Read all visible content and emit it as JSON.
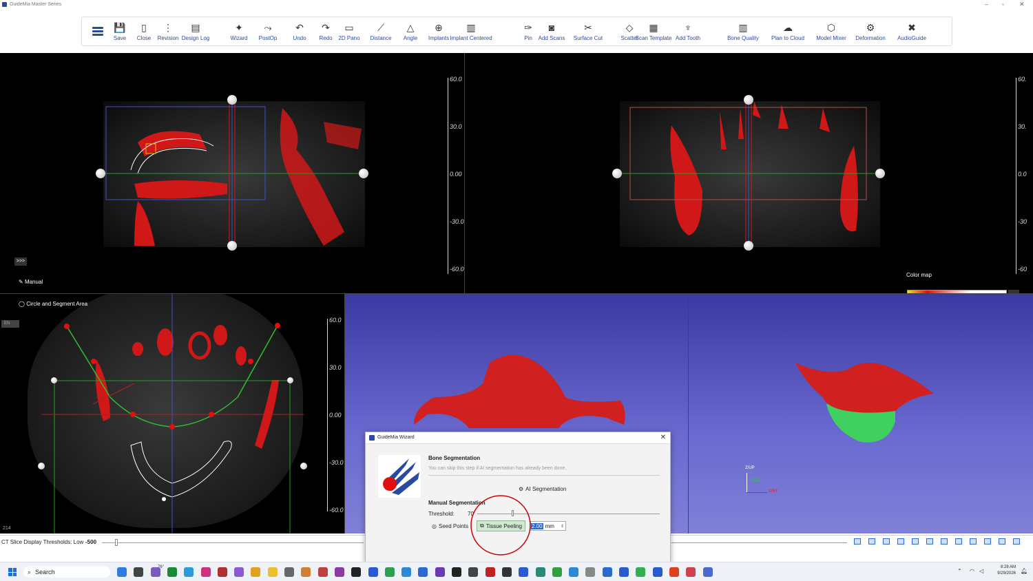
{
  "app": {
    "title": "GuideMia Master Series"
  },
  "toolbar": {
    "items": [
      {
        "label": "Save",
        "icon": "save-icon"
      },
      {
        "label": "Close",
        "icon": "close-file-icon"
      },
      {
        "label": "Revision",
        "icon": "revision-icon"
      },
      {
        "label": "Design Log",
        "icon": "design-log-icon"
      },
      {
        "label": "Wizard",
        "icon": "wizard-icon"
      },
      {
        "label": "PostOp",
        "icon": "postop-icon"
      },
      {
        "label": "Undo",
        "icon": "undo-icon"
      },
      {
        "label": "Redo",
        "icon": "redo-icon"
      },
      {
        "label": "2D Pano",
        "icon": "pano-icon"
      },
      {
        "label": "Distance",
        "icon": "ruler-icon"
      },
      {
        "label": "Angle",
        "icon": "angle-icon"
      },
      {
        "label": "Implants",
        "icon": "implant-icon"
      },
      {
        "label": "Implant Centered",
        "icon": "implant-centered-icon"
      },
      {
        "label": "Pin",
        "icon": "pin-icon"
      },
      {
        "label": "Add Scans",
        "icon": "camera-icon"
      },
      {
        "label": "Surface Cut",
        "icon": "scissors-icon"
      },
      {
        "label": "Scatter",
        "icon": "eraser-icon"
      },
      {
        "label": "Scan Template",
        "icon": "template-icon"
      },
      {
        "label": "Add Tooth",
        "icon": "tooth-icon"
      },
      {
        "label": "Bone Quality",
        "icon": "bar-chart-icon"
      },
      {
        "label": "Plan to Cloud",
        "icon": "cloud-upload-icon"
      },
      {
        "label": "Model Mixer",
        "icon": "cube-icon"
      },
      {
        "label": "Deformation",
        "icon": "deformation-icon"
      },
      {
        "label": "AudioGuide",
        "icon": "mic-off-icon"
      }
    ]
  },
  "viewports": {
    "ruler_ticks": [
      "60.0",
      "30.0",
      "0.00",
      "-30.0",
      "-60.0"
    ],
    "ruler_ticks_right": [
      "60.",
      "30.",
      "0.0",
      "-30",
      "-60"
    ],
    "expand_label": ">>>",
    "manual_label": "Manual",
    "circle_label": "Circle and Segment Area",
    "lang_badge": "EN",
    "slice_number": "214",
    "color_map_label": "Color map",
    "axis_z": "Z/UP",
    "axis_y": "Y/LO",
    "axis_x": "X/RT"
  },
  "ct_bar": {
    "label": "CT Slice Display Thresholds: Low",
    "value": "-500"
  },
  "dialog": {
    "title": "GuideMia Wizard",
    "section_title": "Bone Segmentation",
    "hint": "You can skip this step if AI segmentation has already been done.",
    "ai_button": "AI Segmentation",
    "manual_title": "Manual Segmentation",
    "threshold_label": "Threshold:",
    "threshold_value": "70",
    "threshold_fraction": 0.19,
    "seed_points": "Seed Points",
    "tissue_peeling": "Tissue Peeling",
    "thickness_value": "2.00",
    "thickness_unit": "mm"
  },
  "taskbar": {
    "search": "Search",
    "weather": "76°",
    "time": "8:28 AM",
    "date": "9/29/2026"
  },
  "colors": {
    "accent": "#2a4aa0",
    "bone": "#d01818",
    "highlight": "#cc0000"
  }
}
